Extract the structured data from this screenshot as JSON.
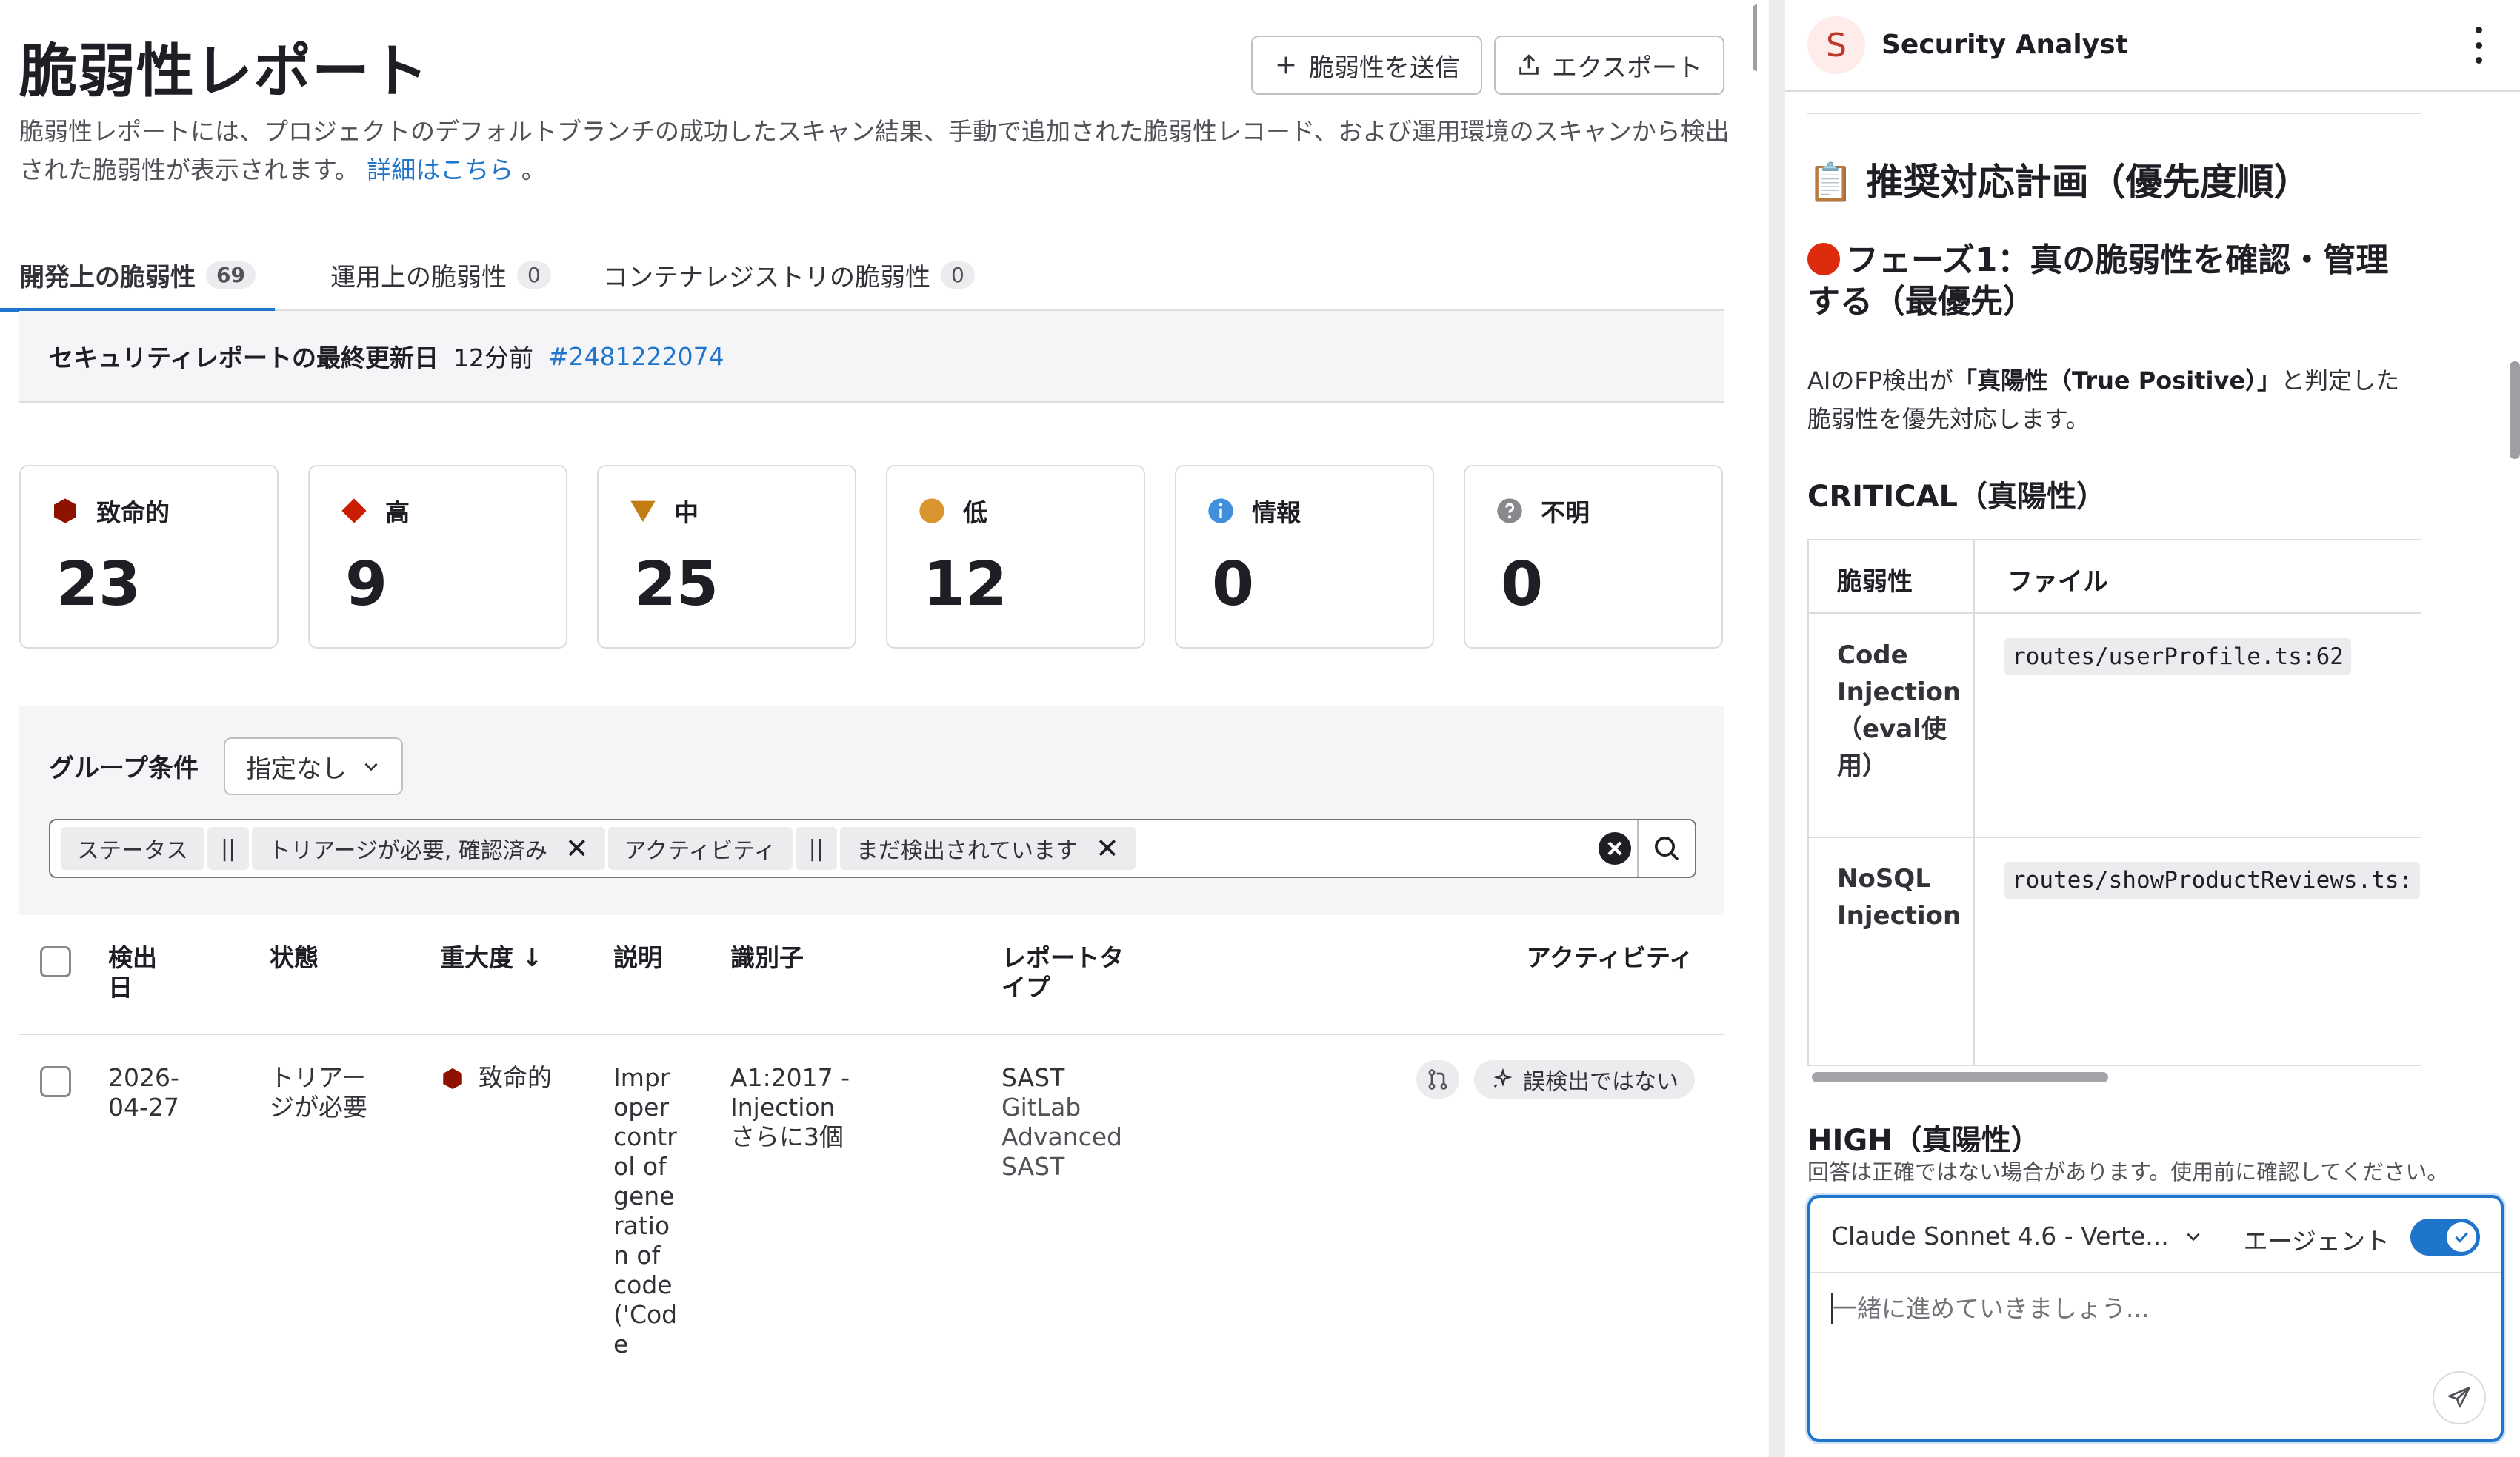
{
  "header": {
    "title": "脆弱性レポート",
    "submit_label": "脆弱性を送信",
    "export_label": "エクスポート",
    "description": "脆弱性レポートには、プロジェクトのデフォルトブランチの成功したスキャン結果、手動で追加された脆弱性レコード、および運用環境のスキャンから検出された脆弱性が表示されます。",
    "learn_more": "詳細はこちら",
    "learn_more_suffix": "。"
  },
  "tabs": [
    {
      "label": "開発上の脆弱性",
      "count": "69"
    },
    {
      "label": "運用上の脆弱性",
      "count": "0"
    },
    {
      "label": "コンテナレジストリの脆弱性",
      "count": "0"
    }
  ],
  "last_updated": {
    "label": "セキュリティレポートの最終更新日",
    "time": "12分前",
    "pipeline": "#2481222074"
  },
  "severity": [
    {
      "label": "致命的",
      "count": "23",
      "color": "#8d1300"
    },
    {
      "label": "高",
      "count": "9",
      "color": "#c91c00"
    },
    {
      "label": "中",
      "count": "25",
      "color": "#c17d10"
    },
    {
      "label": "低",
      "count": "12",
      "color": "#d99530"
    },
    {
      "label": "情報",
      "count": "0",
      "color": "#428fdc"
    },
    {
      "label": "不明",
      "count": "0",
      "color": "#89888d"
    }
  ],
  "filters": {
    "group_label": "グループ条件",
    "group_value": "指定なし",
    "tokens": [
      {
        "key": "ステータス",
        "op": "||",
        "value": "トリアージが必要, 確認済み"
      },
      {
        "key": "アクティビティ",
        "op": "||",
        "value": "まだ検出されています"
      }
    ]
  },
  "table": {
    "headers": {
      "detected": "検出日",
      "status": "状態",
      "severity": "重大度 ↓",
      "description": "説明",
      "identifier": "識別子",
      "report_type": "レポートタイプ",
      "activity": "アクティビティ"
    },
    "rows": [
      {
        "detected": "2026-04-27",
        "status": "トリアージが必要",
        "severity": "致命的",
        "description": "Improper control of generation of code ('Code",
        "identifier": "A1:2017 - Injection",
        "identifier_more": "さらに3個",
        "report_type": "SAST",
        "scanner": "GitLab Advanced SAST",
        "activity_badge": "誤検出ではない"
      }
    ]
  },
  "panel": {
    "avatar_letter": "S",
    "title": "Security Analyst",
    "h2": "📋 推奨対応計画（優先度順）",
    "h3": "フェーズ1：真の脆弱性を確認・管理する（最優先）",
    "para_pre": "AIのFP検出が",
    "para_bold": "「真陽性（True Positive）」",
    "para_post": "と判定した脆弱性を優先対応します。",
    "h4_critical": "CRITICAL（真陽性）",
    "tbl_head_vuln": "脆弱性",
    "tbl_head_file": "ファイル",
    "tbl_rows": [
      {
        "vuln": "Code Injection（eval使用）",
        "file": "routes/userProfile.ts:62"
      },
      {
        "vuln": "NoSQL Injection",
        "file": "routes/showProductReviews.ts:"
      }
    ],
    "h4_high": "HIGH（真陽性）",
    "disclaimer": "回答は正確ではない場合があります。使用前に確認してください。",
    "model": "Claude Sonnet 4.6 - Verte...",
    "agent_label": "エージェント",
    "input_placeholder": "一緒に進めていきましょう..."
  }
}
